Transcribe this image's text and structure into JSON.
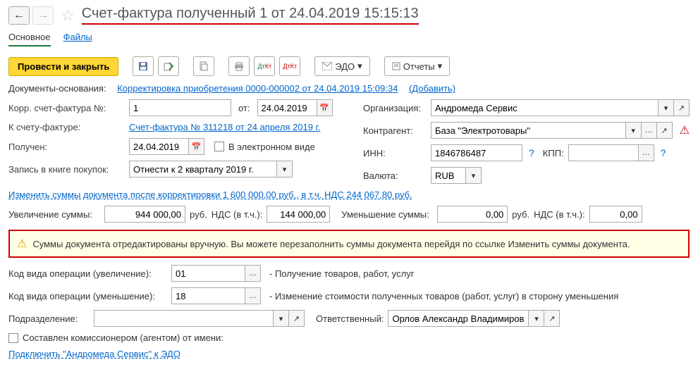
{
  "title": "Счет-фактура полученный 1 от 24.04.2019 15:15:13",
  "tabs": {
    "main": "Основное",
    "files": "Файлы"
  },
  "toolbar": {
    "post_close": "Провести и закрыть",
    "edo": "ЭДО",
    "reports": "Отчеты"
  },
  "base_docs": {
    "label": "Документы-основания:",
    "link": "Корректировка приобретения 0000-000002 от 24.04.2019 15:09:34",
    "add": "(Добавить)"
  },
  "corr_num": {
    "label": "Корр. счет-фактура №:",
    "value": "1",
    "from": "от:",
    "date": "24.04.2019"
  },
  "to_invoice": {
    "label": "К счету-фактуре:",
    "link": "Счет-фактура № 311218 от 24 апреля 2019 г."
  },
  "received": {
    "label": "Получен:",
    "date": "24.04.2019",
    "electronic": "В электронном виде"
  },
  "purchase_book": {
    "label": "Запись в книге покупок:",
    "value": "Отнести к 2 кварталу 2019 г."
  },
  "org": {
    "label": "Организация:",
    "value": "Андромеда Сервис"
  },
  "contractor": {
    "label": "Контрагент:",
    "value": "База \"Электротовары\""
  },
  "inn": {
    "label": "ИНН:",
    "value": "1846786487",
    "kpp": "КПП:"
  },
  "currency": {
    "label": "Валюта:",
    "value": "RUB"
  },
  "change_sums": "Изменить суммы документа после корректировки 1 600 000,00 руб., в т.ч. НДС 244 067,80 руб.",
  "increase": {
    "label": "Увеличение суммы:",
    "value": "944 000,00",
    "rub": "руб.",
    "vat": "НДС (в т.ч.):",
    "vat_value": "144 000,00"
  },
  "decrease": {
    "label": "Уменьшение суммы:",
    "value": "0,00",
    "rub": "руб.",
    "vat": "НДС (в т.ч.):",
    "vat_value": "0,00"
  },
  "warning": "Суммы документа отредактированы вручную. Вы можете перезаполнить суммы документа перейдя по ссылке Изменить суммы документа.",
  "op_inc": {
    "label": "Код вида операции (увеличение):",
    "value": "01",
    "desc": "- Получение товаров, работ, услуг"
  },
  "op_dec": {
    "label": "Код вида операции (уменьшение):",
    "value": "18",
    "desc": "- Изменение стоимости полученных товаров (работ, услуг) в сторону уменьшения"
  },
  "division": {
    "label": "Подразделение:"
  },
  "responsible": {
    "label": "Ответственный:",
    "value": "Орлов Александр Владимиров"
  },
  "commission": "Составлен комиссионером (агентом) от имени:",
  "edo_link": "Подключить \"Андромеда Сервис\" к ЭДО"
}
